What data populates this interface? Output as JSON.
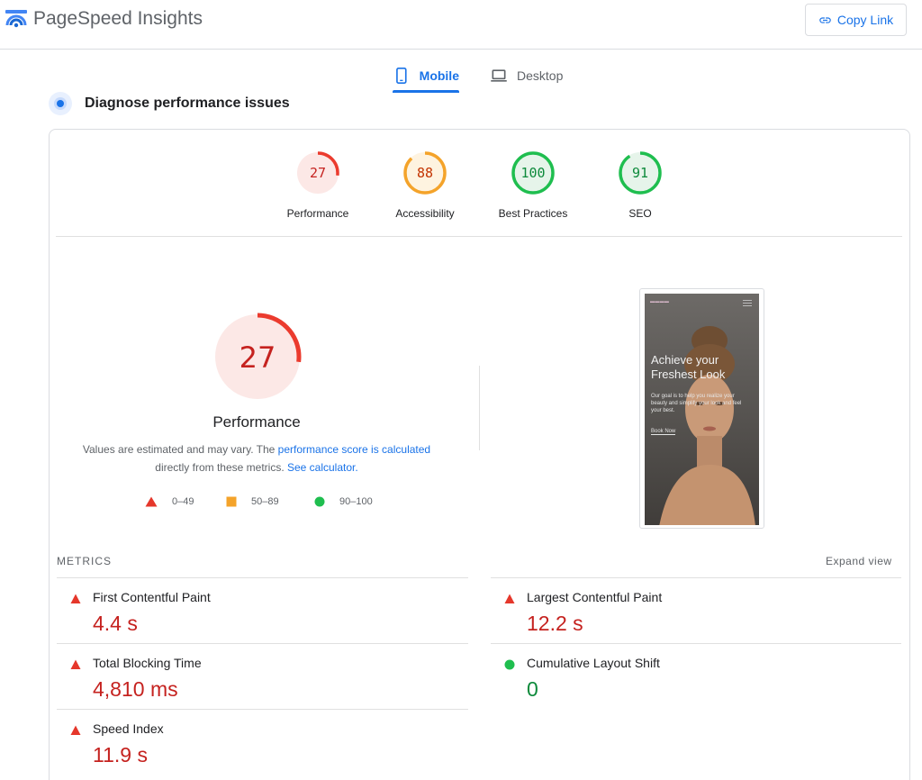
{
  "header": {
    "brand": "PageSpeed Insights",
    "copy_link_label": "Copy Link",
    "accent": "#1a73e8"
  },
  "tabs": [
    {
      "label": "Mobile",
      "icon": "smartphone-icon",
      "active": true
    },
    {
      "label": "Desktop",
      "icon": "laptop-icon",
      "active": false
    }
  ],
  "section_title": "Diagnose performance issues",
  "categories": [
    {
      "label": "Performance",
      "score": "27",
      "fraction": 0.27,
      "status": "fail",
      "color": "#eb3b2e"
    },
    {
      "label": "Accessibility",
      "score": "88",
      "fraction": 0.88,
      "status": "average",
      "color": "#f4a32a"
    },
    {
      "label": "Best Practices",
      "score": "100",
      "fraction": 1.0,
      "status": "pass",
      "color": "#1fbe4f"
    },
    {
      "label": "SEO",
      "score": "91",
      "fraction": 0.91,
      "status": "pass",
      "color": "#1fbe4f"
    }
  ],
  "summary": {
    "score": "27",
    "fraction": 0.27,
    "label": "Performance",
    "desc_prefix": "Values are estimated and may vary. The ",
    "desc_link1": "performance score is calculated",
    "desc_middle": " directly from these metrics. ",
    "desc_link2": "See calculator.",
    "legend": [
      {
        "range": "0–49",
        "shape": "triangle",
        "color": "#e5372b"
      },
      {
        "range": "50–89",
        "shape": "square",
        "color": "#f4a32a"
      },
      {
        "range": "90–100",
        "shape": "circle",
        "color": "#1fbe4f"
      }
    ]
  },
  "screenshot": {
    "headline": "Achieve your Freshest Look",
    "paragraph": "Our goal is to help you realize your beauty and simplify your look and feel your best.",
    "cta": "Book Now"
  },
  "metrics": {
    "title": "METRICS",
    "expand_label": "Expand view",
    "items": [
      {
        "name": "First Contentful Paint",
        "value": "4.4 s",
        "status": "fail"
      },
      {
        "name": "Largest Contentful Paint",
        "value": "12.2 s",
        "status": "fail"
      },
      {
        "name": "Total Blocking Time",
        "value": "4,810 ms",
        "status": "fail"
      },
      {
        "name": "Cumulative Layout Shift",
        "value": "0",
        "status": "pass"
      },
      {
        "name": "Speed Index",
        "value": "11.9 s",
        "status": "fail"
      }
    ]
  }
}
